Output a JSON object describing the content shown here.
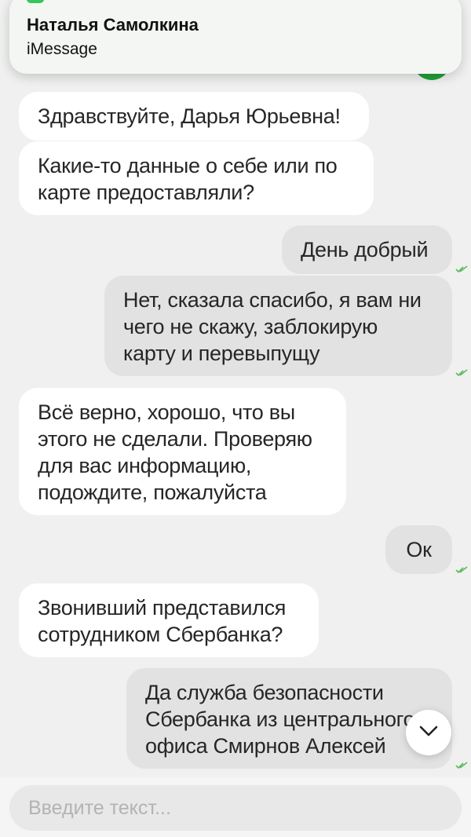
{
  "notification": {
    "title": "Наталья Самолкина",
    "subtitle": "iMessage",
    "app_icon": "messages-app-icon"
  },
  "messages": [
    {
      "direction": "incoming",
      "text": "Здравствуйте, Дарья Юрьевна!"
    },
    {
      "direction": "incoming",
      "text": "Какие-то данные о себе или по\nкарте предоставляли?"
    },
    {
      "direction": "outgoing",
      "text": "День добрый",
      "read": true
    },
    {
      "direction": "outgoing",
      "text": "Нет, сказала спасибо, я вам ни\nчего не скажу, заблокирую\nкарту и перевыпущу",
      "read": true
    },
    {
      "direction": "incoming",
      "text": "Всё верно, хорошо, что вы\nэтого не сделали. Проверяю\nдля вас информацию,\nподождите, пожалуйста"
    },
    {
      "direction": "outgoing",
      "text": "Ок",
      "read": true
    },
    {
      "direction": "incoming",
      "text": "Звонивший представился\nсотрудником Сбербанка?"
    },
    {
      "direction": "outgoing",
      "text": "Да служба безопасности\nСбербанка из центрального\nофиса Смирнов Алексей",
      "read": true
    }
  ],
  "composer": {
    "placeholder": "Введите текст..."
  },
  "colors": {
    "background": "#f0f0f0",
    "incoming_bubble": "#ffffff",
    "outgoing_bubble": "#e2e2e2",
    "read_check": "#5cb85c",
    "accent": "#21a038"
  },
  "icons": {
    "scroll_down": "chevron-down-icon",
    "read_receipt": "double-check-icon"
  }
}
